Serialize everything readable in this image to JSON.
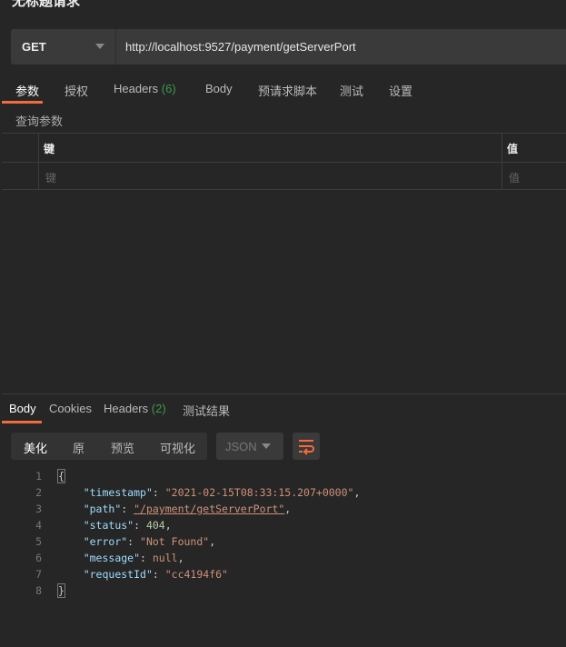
{
  "title": "无标题请求",
  "request": {
    "method": "GET",
    "url": "http://localhost:9527/payment/getServerPort"
  },
  "request_tabs": [
    {
      "label": "参数"
    },
    {
      "label": "授权"
    },
    {
      "label": "Headers",
      "count": "(6)"
    },
    {
      "label": "Body"
    },
    {
      "label": "预请求脚本"
    },
    {
      "label": "测试"
    },
    {
      "label": "设置"
    }
  ],
  "params": {
    "section": "查询参数",
    "headers": {
      "key": "键",
      "value": "值"
    },
    "placeholders": {
      "key": "键",
      "value": "值"
    }
  },
  "response_tabs": [
    {
      "label": "Body"
    },
    {
      "label": "Cookies"
    },
    {
      "label": "Headers",
      "count": "(2)"
    },
    {
      "label": "测试结果"
    }
  ],
  "format_buttons": [
    "美化",
    "原",
    "预览",
    "可视化"
  ],
  "language": "JSON",
  "accent": "#f26b3a",
  "body_lines": [
    {
      "n": "1",
      "text": "{"
    },
    {
      "n": "2",
      "key": "\"timestamp\"",
      "val": "\"2021-02-15T08:33:15.207+0000\"",
      "tail": ","
    },
    {
      "n": "3",
      "key": "\"path\"",
      "val": "\"/payment/getServerPort\"",
      "tail": ","
    },
    {
      "n": "4",
      "key": "\"status\"",
      "val": "404",
      "tail": ","
    },
    {
      "n": "5",
      "key": "\"error\"",
      "val": "\"Not Found\"",
      "tail": ","
    },
    {
      "n": "6",
      "key": "\"message\"",
      "val": "null",
      "tail": ","
    },
    {
      "n": "7",
      "key": "\"requestId\"",
      "val": "\"cc4194f6\"",
      "tail": ""
    },
    {
      "n": "8",
      "text": "}"
    }
  ]
}
